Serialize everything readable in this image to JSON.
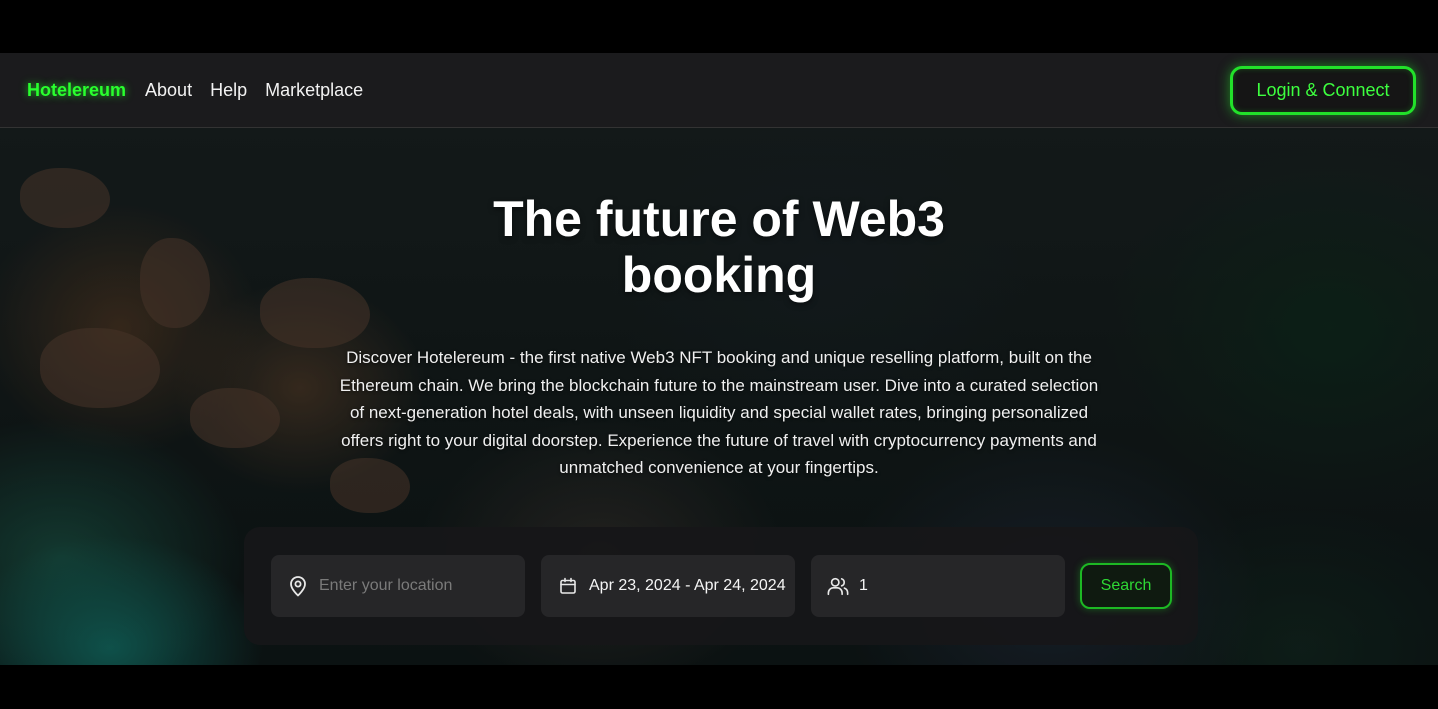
{
  "navbar": {
    "brand": "Hotelereum",
    "links": [
      "About",
      "Help",
      "Marketplace"
    ],
    "login_label": "Login & Connect"
  },
  "hero": {
    "title": "The future of Web3 booking",
    "description": "Discover Hotelereum - the first native Web3 NFT booking and unique reselling platform, built on the Ethereum chain. We bring the blockchain future to the mainstream user. Dive into a curated selection of next-generation hotel deals, with unseen liquidity and special wallet rates, bringing personalized offers right to your digital doorstep. Experience the future of travel with cryptocurrency payments and unmatched convenience at your fingertips."
  },
  "search": {
    "location_placeholder": "Enter your location",
    "location_value": "",
    "dates": "Apr 23, 2024 - Apr 24, 2024",
    "guests": "1",
    "button_label": "Search"
  },
  "icons": {
    "location": "map-pin-icon",
    "calendar": "calendar-icon",
    "guests": "users-icon"
  },
  "colors": {
    "accent": "#29ff2e",
    "navbar_bg": "#1b1b1d",
    "panel_bg": "#161618",
    "field_bg": "#262628"
  }
}
